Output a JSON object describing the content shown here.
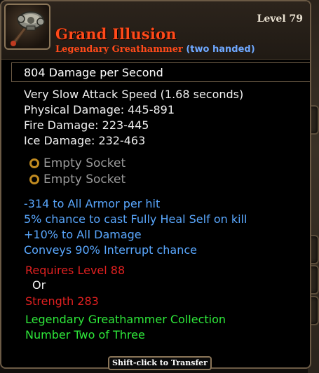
{
  "item": {
    "name": "Grand Illusion",
    "type_label": "Legendary Greathammer",
    "handedness": "(two handed)",
    "level_label": "Level 79",
    "icon": "greathammer-icon"
  },
  "dps": {
    "text": "804  Damage per Second"
  },
  "stats": [
    "Very Slow Attack Speed (1.68 seconds)",
    "Physical Damage: 445-891",
    "Fire Damage: 223-445",
    "Ice Damage: 232-463"
  ],
  "sockets": [
    "Empty Socket",
    "Empty Socket"
  ],
  "magic_properties": [
    "-314 to All Armor per hit",
    "5% chance to cast Fully Heal Self on kill",
    "+10% to All Damage",
    "Conveys 90% Interrupt chance"
  ],
  "requirements": {
    "level": "Requires Level 88",
    "or": "Or",
    "strength": "Strength 283"
  },
  "set_info": {
    "collection": "Legendary Greathammer Collection",
    "index": "Number Two of Three"
  },
  "transfer_hint": "Shift-click to Transfer",
  "colors": {
    "legendary": "#ff4a1a",
    "magic": "#5aa8ff",
    "requirement_unmet": "#e02020",
    "set": "#2ee83a",
    "socket_ring": "#c08a20"
  }
}
